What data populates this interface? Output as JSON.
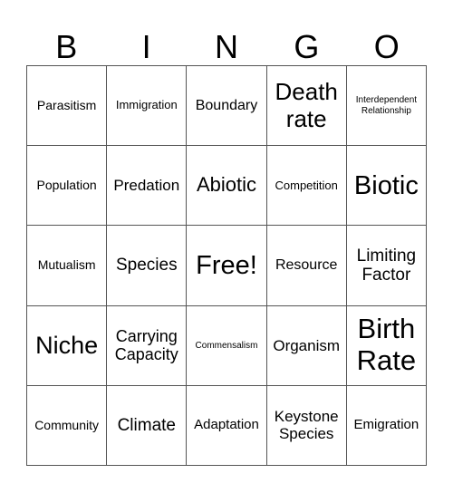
{
  "header": [
    "B",
    "I",
    "N",
    "G",
    "O"
  ],
  "cells": [
    [
      "Parasitism",
      "Immigration",
      "Boundary",
      "Death rate",
      "Interdependent Relationship"
    ],
    [
      "Population",
      "Predation",
      "Abiotic",
      "Competition",
      "Biotic"
    ],
    [
      "Mutualism",
      "Species",
      "Free!",
      "Resource",
      "Limiting Factor"
    ],
    [
      "Niche",
      "Carrying Capacity",
      "Commensalism",
      "Organism",
      "Birth Rate"
    ],
    [
      "Community",
      "Climate",
      "Adaptation",
      "Keystone Species",
      "Emigration"
    ]
  ]
}
